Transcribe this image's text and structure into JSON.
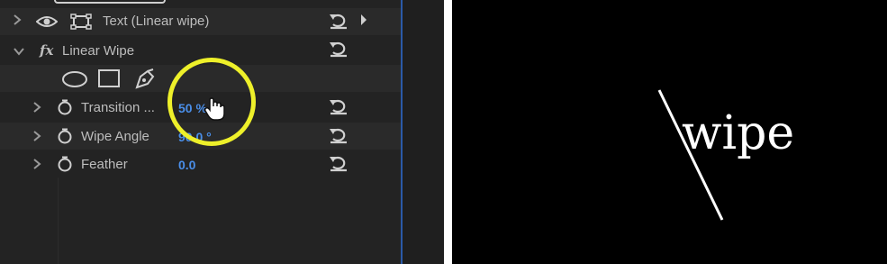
{
  "effect_controls": {
    "text_layer": {
      "label": "Text (Linear wipe)"
    },
    "effect": {
      "icon": "fx-icon",
      "name": "Linear Wipe",
      "mask_tools": [
        "ellipse-mask-icon",
        "rectangle-mask-icon",
        "pen-mask-icon"
      ],
      "properties": [
        {
          "label": "Transition ...",
          "value": "50 %"
        },
        {
          "label": "Wipe Angle",
          "value": "90.0 °"
        },
        {
          "label": "Feather",
          "value": "0.0"
        }
      ]
    }
  },
  "annotation": {
    "color": "#eef02a"
  },
  "preview": {
    "text": "wipe"
  }
}
